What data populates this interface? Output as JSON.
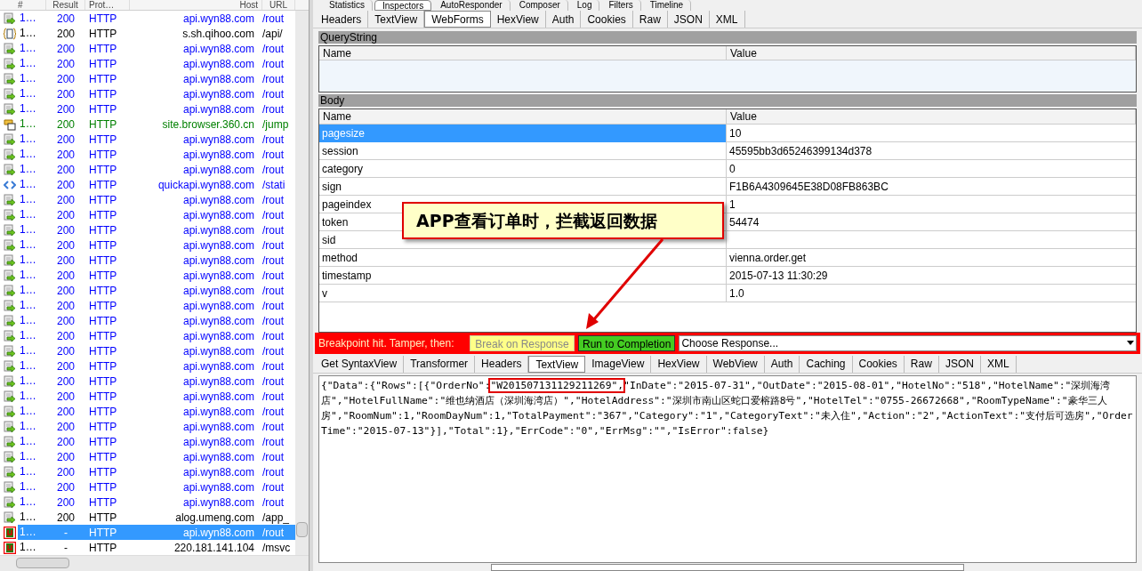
{
  "top_tabs": [
    {
      "label": "Statistics",
      "selected": false
    },
    {
      "label": "Inspectors",
      "selected": true
    },
    {
      "label": "AutoResponder",
      "selected": false
    },
    {
      "label": "Composer",
      "selected": false
    },
    {
      "label": "Log",
      "selected": false
    },
    {
      "label": "Filters",
      "selected": false
    },
    {
      "label": "Timeline",
      "selected": false
    }
  ],
  "session_list": {
    "columns": [
      "#",
      "Result",
      "Prot…",
      "Host",
      "URL"
    ],
    "rows": [
      {
        "kind": "response",
        "num": "1…",
        "result": "200",
        "protocol": "HTTP",
        "host": "api.wyn88.com",
        "url": "/rout",
        "color": "#0000ff",
        "selected": false
      },
      {
        "kind": "json",
        "num": "1…",
        "result": "200",
        "protocol": "HTTP",
        "host": "s.sh.qihoo.com",
        "url": "/api/",
        "color": "#000000",
        "selected": false
      },
      {
        "kind": "response",
        "num": "1…",
        "result": "200",
        "protocol": "HTTP",
        "host": "api.wyn88.com",
        "url": "/rout",
        "color": "#0000ff",
        "selected": false
      },
      {
        "kind": "response",
        "num": "1…",
        "result": "200",
        "protocol": "HTTP",
        "host": "api.wyn88.com",
        "url": "/rout",
        "color": "#0000ff",
        "selected": false
      },
      {
        "kind": "response",
        "num": "1…",
        "result": "200",
        "protocol": "HTTP",
        "host": "api.wyn88.com",
        "url": "/rout",
        "color": "#0000ff",
        "selected": false
      },
      {
        "kind": "response",
        "num": "1…",
        "result": "200",
        "protocol": "HTTP",
        "host": "api.wyn88.com",
        "url": "/rout",
        "color": "#0000ff",
        "selected": false
      },
      {
        "kind": "response",
        "num": "1…",
        "result": "200",
        "protocol": "HTTP",
        "host": "api.wyn88.com",
        "url": "/rout",
        "color": "#0000ff",
        "selected": false
      },
      {
        "kind": "script",
        "num": "1…",
        "result": "200",
        "protocol": "HTTP",
        "host": "site.browser.360.cn",
        "url": "/jump",
        "color": "#008000",
        "selected": false
      },
      {
        "kind": "response",
        "num": "1…",
        "result": "200",
        "protocol": "HTTP",
        "host": "api.wyn88.com",
        "url": "/rout",
        "color": "#0000ff",
        "selected": false
      },
      {
        "kind": "response",
        "num": "1…",
        "result": "200",
        "protocol": "HTTP",
        "host": "api.wyn88.com",
        "url": "/rout",
        "color": "#0000ff",
        "selected": false
      },
      {
        "kind": "response",
        "num": "1…",
        "result": "200",
        "protocol": "HTTP",
        "host": "api.wyn88.com",
        "url": "/rout",
        "color": "#0000ff",
        "selected": false
      },
      {
        "kind": "style",
        "num": "1…",
        "result": "200",
        "protocol": "HTTP",
        "host": "quickapi.wyn88.com",
        "url": "/stati",
        "color": "#0000ff",
        "selected": false
      },
      {
        "kind": "response",
        "num": "1…",
        "result": "200",
        "protocol": "HTTP",
        "host": "api.wyn88.com",
        "url": "/rout",
        "color": "#0000ff",
        "selected": false
      },
      {
        "kind": "response",
        "num": "1…",
        "result": "200",
        "protocol": "HTTP",
        "host": "api.wyn88.com",
        "url": "/rout",
        "color": "#0000ff",
        "selected": false
      },
      {
        "kind": "response",
        "num": "1…",
        "result": "200",
        "protocol": "HTTP",
        "host": "api.wyn88.com",
        "url": "/rout",
        "color": "#0000ff",
        "selected": false
      },
      {
        "kind": "response",
        "num": "1…",
        "result": "200",
        "protocol": "HTTP",
        "host": "api.wyn88.com",
        "url": "/rout",
        "color": "#0000ff",
        "selected": false
      },
      {
        "kind": "response",
        "num": "1…",
        "result": "200",
        "protocol": "HTTP",
        "host": "api.wyn88.com",
        "url": "/rout",
        "color": "#0000ff",
        "selected": false
      },
      {
        "kind": "response",
        "num": "1…",
        "result": "200",
        "protocol": "HTTP",
        "host": "api.wyn88.com",
        "url": "/rout",
        "color": "#0000ff",
        "selected": false
      },
      {
        "kind": "response",
        "num": "1…",
        "result": "200",
        "protocol": "HTTP",
        "host": "api.wyn88.com",
        "url": "/rout",
        "color": "#0000ff",
        "selected": false
      },
      {
        "kind": "response",
        "num": "1…",
        "result": "200",
        "protocol": "HTTP",
        "host": "api.wyn88.com",
        "url": "/rout",
        "color": "#0000ff",
        "selected": false
      },
      {
        "kind": "response",
        "num": "1…",
        "result": "200",
        "protocol": "HTTP",
        "host": "api.wyn88.com",
        "url": "/rout",
        "color": "#0000ff",
        "selected": false
      },
      {
        "kind": "response",
        "num": "1…",
        "result": "200",
        "protocol": "HTTP",
        "host": "api.wyn88.com",
        "url": "/rout",
        "color": "#0000ff",
        "selected": false
      },
      {
        "kind": "response",
        "num": "1…",
        "result": "200",
        "protocol": "HTTP",
        "host": "api.wyn88.com",
        "url": "/rout",
        "color": "#0000ff",
        "selected": false
      },
      {
        "kind": "response",
        "num": "1…",
        "result": "200",
        "protocol": "HTTP",
        "host": "api.wyn88.com",
        "url": "/rout",
        "color": "#0000ff",
        "selected": false
      },
      {
        "kind": "response",
        "num": "1…",
        "result": "200",
        "protocol": "HTTP",
        "host": "api.wyn88.com",
        "url": "/rout",
        "color": "#0000ff",
        "selected": false
      },
      {
        "kind": "response",
        "num": "1…",
        "result": "200",
        "protocol": "HTTP",
        "host": "api.wyn88.com",
        "url": "/rout",
        "color": "#0000ff",
        "selected": false
      },
      {
        "kind": "response",
        "num": "1…",
        "result": "200",
        "protocol": "HTTP",
        "host": "api.wyn88.com",
        "url": "/rout",
        "color": "#0000ff",
        "selected": false
      },
      {
        "kind": "response",
        "num": "1…",
        "result": "200",
        "protocol": "HTTP",
        "host": "api.wyn88.com",
        "url": "/rout",
        "color": "#0000ff",
        "selected": false
      },
      {
        "kind": "response",
        "num": "1…",
        "result": "200",
        "protocol": "HTTP",
        "host": "api.wyn88.com",
        "url": "/rout",
        "color": "#0000ff",
        "selected": false
      },
      {
        "kind": "response",
        "num": "1…",
        "result": "200",
        "protocol": "HTTP",
        "host": "api.wyn88.com",
        "url": "/rout",
        "color": "#0000ff",
        "selected": false
      },
      {
        "kind": "response",
        "num": "1…",
        "result": "200",
        "protocol": "HTTP",
        "host": "api.wyn88.com",
        "url": "/rout",
        "color": "#0000ff",
        "selected": false
      },
      {
        "kind": "response",
        "num": "1…",
        "result": "200",
        "protocol": "HTTP",
        "host": "api.wyn88.com",
        "url": "/rout",
        "color": "#0000ff",
        "selected": false
      },
      {
        "kind": "response",
        "num": "1…",
        "result": "200",
        "protocol": "HTTP",
        "host": "api.wyn88.com",
        "url": "/rout",
        "color": "#0000ff",
        "selected": false
      },
      {
        "kind": "response",
        "num": "1…",
        "result": "200",
        "protocol": "HTTP",
        "host": "alog.umeng.com",
        "url": "/app_",
        "color": "#000000",
        "selected": false
      },
      {
        "kind": "breakpoint",
        "num": "1…",
        "result": "-",
        "protocol": "HTTP",
        "host": "api.wyn88.com",
        "url": "/rout",
        "selected": true
      },
      {
        "kind": "breakpoint",
        "num": "1…",
        "result": "-",
        "protocol": "HTTP",
        "host": "220.181.141.104",
        "url": "/msvc",
        "color": "#000000",
        "selected": false
      }
    ]
  },
  "request_tabs": [
    {
      "label": "Headers",
      "selected": false
    },
    {
      "label": "TextView",
      "selected": false
    },
    {
      "label": "WebForms",
      "selected": true
    },
    {
      "label": "HexView",
      "selected": false
    },
    {
      "label": "Auth",
      "selected": false
    },
    {
      "label": "Cookies",
      "selected": false
    },
    {
      "label": "Raw",
      "selected": false
    },
    {
      "label": "JSON",
      "selected": false
    },
    {
      "label": "XML",
      "selected": false
    }
  ],
  "querystring": {
    "title": "QueryString",
    "columns": [
      "Name",
      "Value"
    ]
  },
  "body": {
    "title": "Body",
    "columns": [
      "Name",
      "Value"
    ],
    "rows": [
      {
        "name": "pagesize",
        "value": "10",
        "selected": true
      },
      {
        "name": "session",
        "value": "45595bb3d65246399134d378",
        "selected": false
      },
      {
        "name": "category",
        "value": "0",
        "selected": false
      },
      {
        "name": "sign",
        "value": "F1B6A4309645E38D08FB863BC",
        "selected": false
      },
      {
        "name": "pageindex",
        "value": "1",
        "selected": false
      },
      {
        "name": "token",
        "value": "54474",
        "selected": false
      },
      {
        "name": "sid",
        "selected": false
      },
      {
        "name": "method",
        "value": "vienna.order.get",
        "selected": false
      },
      {
        "name": "timestamp",
        "value": "2015-07-13 11:30:29",
        "selected": false
      },
      {
        "name": "v",
        "value": "1.0",
        "selected": false
      }
    ]
  },
  "callout": {
    "text": "APP查看订单时，拦截返回数据"
  },
  "breakpoint_bar": {
    "label": "Breakpoint hit. Tamper, then:",
    "buttons": [
      {
        "label": "Break on Response",
        "kind": "break"
      },
      {
        "label": "Run to Completion",
        "kind": "run"
      }
    ],
    "dropdown": "Choose Response..."
  },
  "response_tabs": [
    {
      "label": "Get SyntaxView",
      "selected": false
    },
    {
      "label": "Transformer",
      "selected": false
    },
    {
      "label": "Headers",
      "selected": false
    },
    {
      "label": "TextView",
      "selected": true
    },
    {
      "label": "ImageView",
      "selected": false
    },
    {
      "label": "HexView",
      "selected": false
    },
    {
      "label": "WebView",
      "selected": false
    },
    {
      "label": "Auth",
      "selected": false
    },
    {
      "label": "Caching",
      "selected": false
    },
    {
      "label": "Cookies",
      "selected": false
    },
    {
      "label": "Raw",
      "selected": false
    },
    {
      "label": "JSON",
      "selected": false
    },
    {
      "label": "XML",
      "selected": false
    }
  ],
  "response_text": {
    "before": "{\"Data\":{\"Rows\":[{\"OrderNo\":",
    "highlight": "\"W201507131129211269\",",
    "after": "\"InDate\":\"2015-07-31\",\"OutDate\":\"2015-08-01\",\"HotelNo\":\"518\",\"HotelName\":\"深圳海湾店\",\"HotelFullName\":\"维也纳酒店（深圳海湾店）\",\"HotelAddress\":\"深圳市南山区蛇口爱榕路8号\",\"HotelTel\":\"0755-26672668\",\"RoomTypeName\":\"豪华三人房\",\"RoomNum\":1,\"RoomDayNum\":1,\"TotalPayment\":\"367\",\"Category\":\"1\",\"CategoryText\":\"未入住\",\"Action\":\"2\",\"ActionText\":\"支付后可选房\",\"OrderTime\":\"2015-07-13\"}],\"Total\":1},\"ErrCode\":\"0\",\"ErrMsg\":\"\",\"IsError\":false}"
  }
}
